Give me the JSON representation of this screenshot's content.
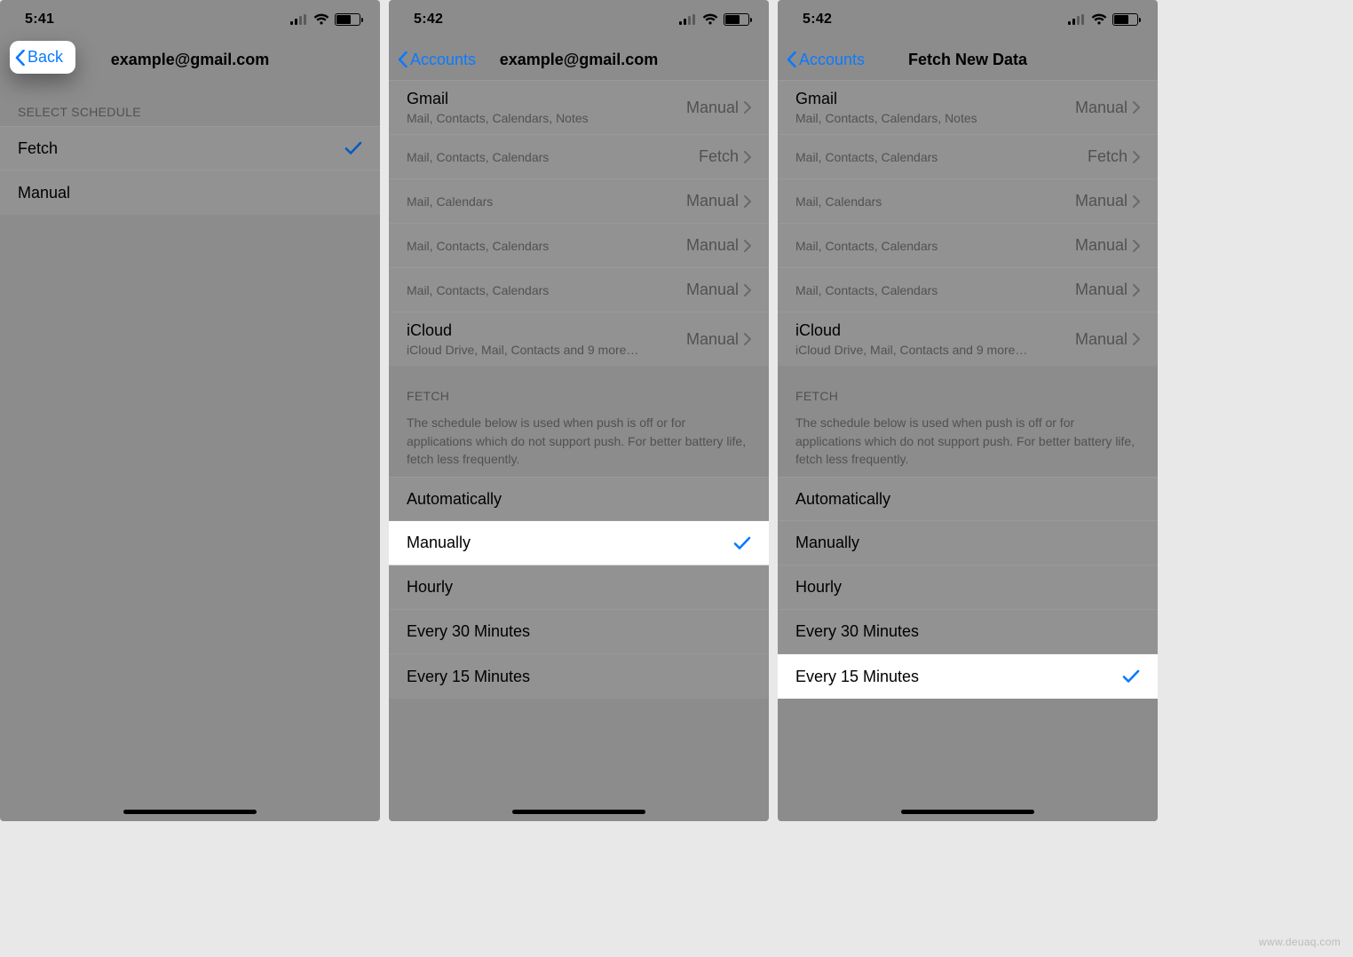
{
  "watermark": "www.deuaq.com",
  "icons": {
    "check_color": "#0a7aff",
    "link_blue": "#0a7aff"
  },
  "panel1": {
    "time": "5:41",
    "back_label": "Back",
    "title": "example@gmail.com",
    "section_label": "SELECT SCHEDULE",
    "rows": [
      {
        "label": "Fetch",
        "checked": true
      },
      {
        "label": "Manual",
        "checked": false
      }
    ]
  },
  "panel2": {
    "time": "5:42",
    "back_label": "Accounts",
    "title": "example@gmail.com",
    "accounts": [
      {
        "name": "Gmail",
        "sub": "Mail, Contacts, Calendars, Notes",
        "value": "Manual"
      },
      {
        "name": "",
        "sub": "Mail, Contacts, Calendars",
        "value": "Fetch"
      },
      {
        "name": "",
        "sub": "Mail, Calendars",
        "value": "Manual"
      },
      {
        "name": "",
        "sub": "Mail, Contacts, Calendars",
        "value": "Manual"
      },
      {
        "name": "",
        "sub": "Mail, Contacts, Calendars",
        "value": "Manual"
      },
      {
        "name": "iCloud",
        "sub": "iCloud Drive, Mail, Contacts and 9 more…",
        "value": "Manual"
      }
    ],
    "fetch_header": "FETCH",
    "fetch_note": "The schedule below is used when push is off or for applications which do not support push. For better battery life, fetch less frequently.",
    "schedule": [
      {
        "label": "Automatically",
        "checked": false
      },
      {
        "label": "Manually",
        "checked": true
      },
      {
        "label": "Hourly",
        "checked": false
      },
      {
        "label": "Every 30 Minutes",
        "checked": false
      },
      {
        "label": "Every 15 Minutes",
        "checked": false
      }
    ]
  },
  "panel3": {
    "time": "5:42",
    "back_label": "Accounts",
    "title": "Fetch New Data",
    "accounts": [
      {
        "name": "Gmail",
        "sub": "Mail, Contacts, Calendars, Notes",
        "value": "Manual"
      },
      {
        "name": "",
        "sub": "Mail, Contacts, Calendars",
        "value": "Fetch"
      },
      {
        "name": "",
        "sub": "Mail, Calendars",
        "value": "Manual"
      },
      {
        "name": "",
        "sub": "Mail, Contacts, Calendars",
        "value": "Manual"
      },
      {
        "name": "",
        "sub": "Mail, Contacts, Calendars",
        "value": "Manual"
      },
      {
        "name": "iCloud",
        "sub": "iCloud Drive, Mail, Contacts and 9 more…",
        "value": "Manual"
      }
    ],
    "fetch_header": "FETCH",
    "fetch_note": "The schedule below is used when push is off or for applications which do not support push. For better battery life, fetch less frequently.",
    "schedule": [
      {
        "label": "Automatically",
        "checked": false
      },
      {
        "label": "Manually",
        "checked": false
      },
      {
        "label": "Hourly",
        "checked": false
      },
      {
        "label": "Every 30 Minutes",
        "checked": false
      },
      {
        "label": "Every 15 Minutes",
        "checked": true
      }
    ]
  }
}
